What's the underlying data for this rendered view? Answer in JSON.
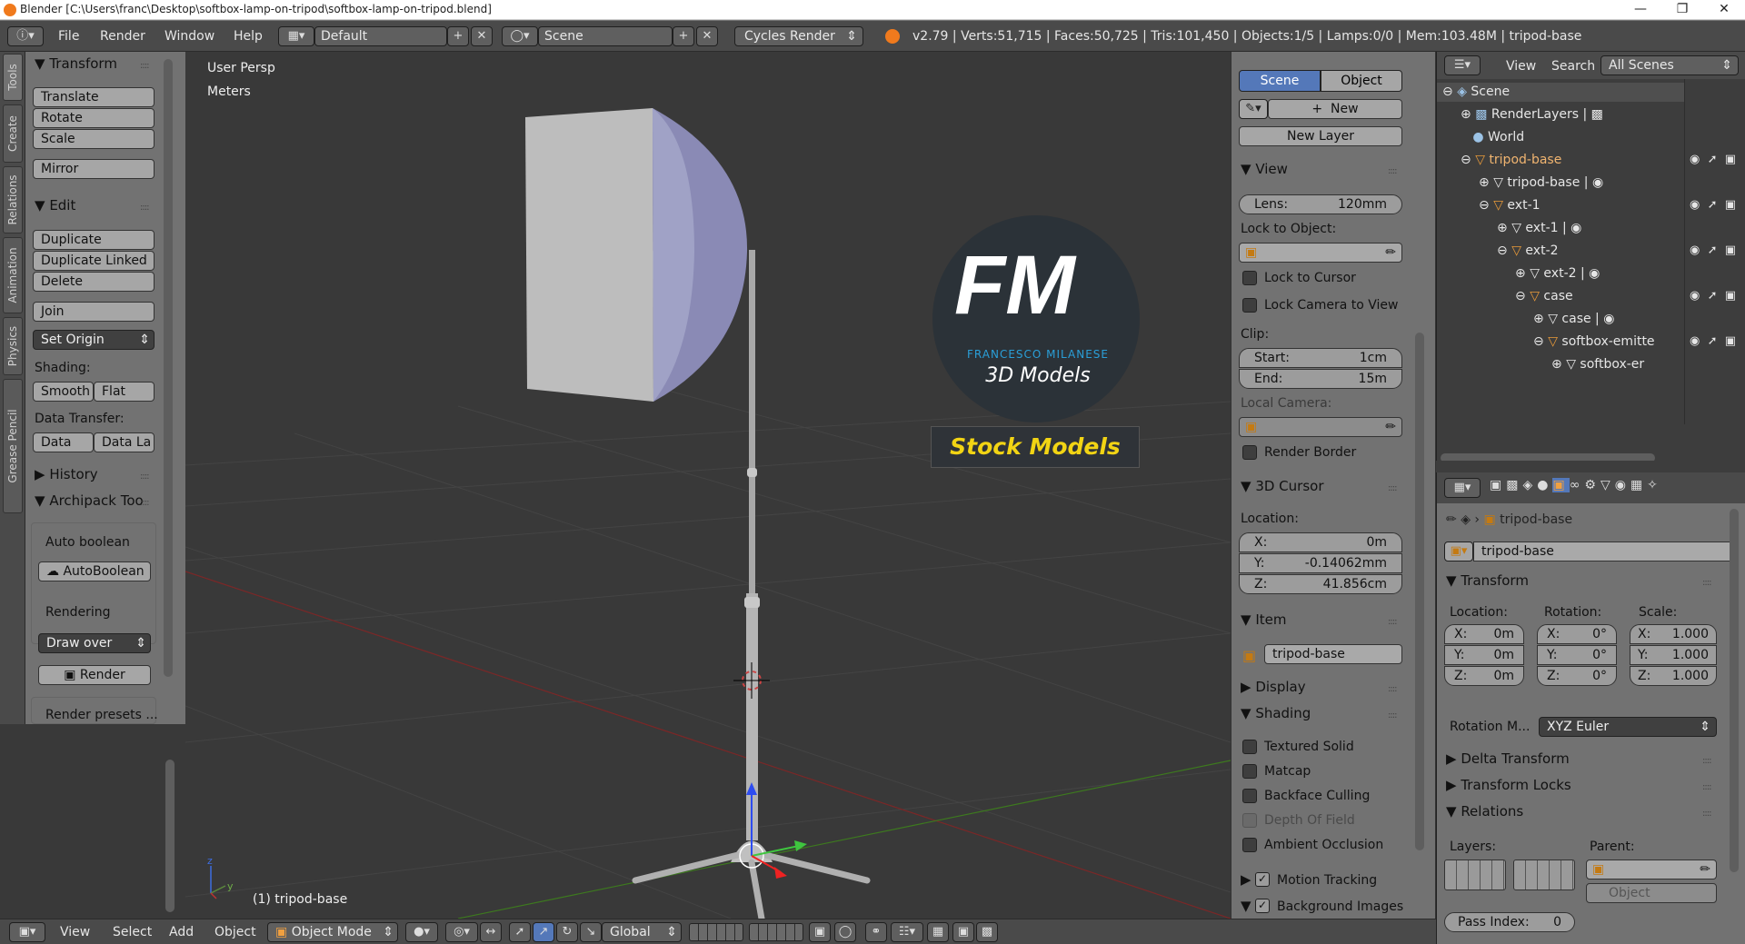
{
  "window": {
    "title": "Blender [C:\\Users\\franc\\Desktop\\softbox-lamp-on-tripod\\softbox-lamp-on-tripod.blend]"
  },
  "topbar": {
    "menus": [
      "File",
      "Render",
      "Window",
      "Help"
    ],
    "layout": "Default",
    "scene": "Scene",
    "engine": "Cycles Render",
    "stats": "v2.79 | Verts:51,715 | Faces:50,725 | Tris:101,450 | Objects:1/5 | Lamps:0/0 | Mem:103.48M | tripod-base"
  },
  "tool_tabs": [
    "Tools",
    "Create",
    "Relations",
    "Animation",
    "Physics",
    "Grease Pencil"
  ],
  "tools": {
    "transform_header": "Transform",
    "translate": "Translate",
    "rotate": "Rotate",
    "scale": "Scale",
    "mirror": "Mirror",
    "edit_header": "Edit",
    "duplicate": "Duplicate",
    "duplicate_linked": "Duplicate Linked",
    "delete": "Delete",
    "join": "Join",
    "set_origin": "Set Origin",
    "shading_label": "Shading:",
    "smooth": "Smooth",
    "flat": "Flat",
    "data_transfer_label": "Data Transfer:",
    "data": "Data",
    "data_la": "Data La",
    "history": "History",
    "archipack": "Archipack Too",
    "auto_boolean_label": "Auto boolean",
    "auto_boolean_btn": "AutoBoolean",
    "rendering_label": "Rendering",
    "draw_over": "Draw over",
    "render": "Render",
    "render_presets": "Render presets ..."
  },
  "viewport": {
    "view_name": "User Persp",
    "units": "Meters",
    "object_label": "(1) tripod-base"
  },
  "watermark": {
    "fm": "FM",
    "name": "FRANCESCO MILANESE",
    "sub": "3D Models",
    "stock": "Stock Models"
  },
  "npanel": {
    "tab_scene": "Scene",
    "tab_object": "Object",
    "new": "New",
    "new_layer": "New Layer",
    "view_header": "View",
    "lens_label": "Lens:",
    "lens_value": "120mm",
    "lock_to_object": "Lock to Object:",
    "lock_to_cursor": "Lock to Cursor",
    "lock_camera": "Lock Camera to View",
    "clip_label": "Clip:",
    "start_label": "Start:",
    "start_value": "1cm",
    "end_label": "End:",
    "end_value": "15m",
    "local_camera": "Local Camera:",
    "render_border": "Render Border",
    "cursor_header": "3D Cursor",
    "location_label": "Location:",
    "x_label": "X:",
    "x_value": "0m",
    "y_label": "Y:",
    "y_value": "-0.14062mm",
    "z_label": "Z:",
    "z_value": "41.856cm",
    "item_header": "Item",
    "item_name": "tripod-base",
    "display_header": "Display",
    "shading_header": "Shading",
    "textured_solid": "Textured Solid",
    "matcap": "Matcap",
    "backface": "Backface Culling",
    "dof": "Depth Of Field",
    "ao": "Ambient Occlusion",
    "motion_tracking": "Motion Tracking",
    "background_images": "Background Images"
  },
  "outliner": {
    "view": "View",
    "search": "Search",
    "scope": "All Scenes",
    "items": [
      "Scene",
      "RenderLayers",
      "World",
      "tripod-base",
      "tripod-base",
      "ext-1",
      "ext-1",
      "ext-2",
      "ext-2",
      "case",
      "case",
      "softbox-emitte",
      "softbox-er"
    ]
  },
  "props": {
    "object_name": "tripod-base",
    "name_field": "tripod-base",
    "transform_header": "Transform",
    "location": "Location:",
    "rotation": "Rotation:",
    "scale": "Scale:",
    "loc": [
      "X:",
      "0m",
      "Y:",
      "0m",
      "Z:",
      "0m"
    ],
    "rot": [
      "X:",
      "0°",
      "Y:",
      "0°",
      "Z:",
      "0°"
    ],
    "scl": [
      "X:",
      "1.000",
      "Y:",
      "1.000",
      "Z:",
      "1.000"
    ],
    "rot_mode_label": "Rotation M...",
    "rot_mode": "XYZ Euler",
    "delta": "Delta Transform",
    "locks": "Transform Locks",
    "relations": "Relations",
    "layers": "Layers:",
    "parent": "Parent:",
    "parent_type": "Object",
    "pass_index": "Pass Index:",
    "pass_value": "0"
  },
  "bottombar": {
    "menus": [
      "View",
      "Select",
      "Add",
      "Object"
    ],
    "mode": "Object Mode",
    "orientation": "Global"
  }
}
